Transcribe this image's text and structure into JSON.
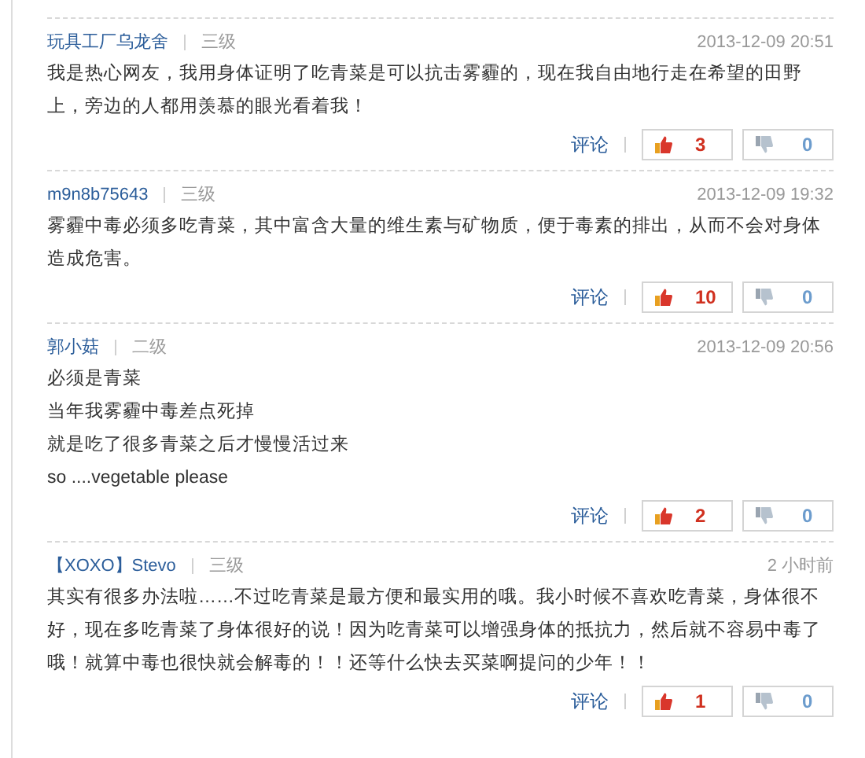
{
  "comments": [
    {
      "user": "玩具工厂乌龙舍",
      "level": "三级",
      "time": "2013-12-09 20:51",
      "lines": [
        "我是热心网友，我用身体证明了吃青菜是可以抗击雾霾的，现在我自由地行走在希望的田野上，旁边的人都用羡慕的眼光看着我！"
      ],
      "reply": "评论",
      "likes": "3",
      "dislikes": "0"
    },
    {
      "user": "m9n8b75643",
      "level": "三级",
      "time": "2013-12-09 19:32",
      "lines": [
        "雾霾中毒必须多吃青菜，其中富含大量的维生素与矿物质，便于毒素的排出，从而不会对身体造成危害。"
      ],
      "reply": "评论",
      "likes": "10",
      "dislikes": "0"
    },
    {
      "user": "郭小菇",
      "level": "二级",
      "time": "2013-12-09 20:56",
      "lines": [
        "必须是青菜",
        "当年我雾霾中毒差点死掉",
        "就是吃了很多青菜之后才慢慢活过来",
        "so ....vegetable please"
      ],
      "reply": "评论",
      "likes": "2",
      "dislikes": "0"
    },
    {
      "user": "【XOXO】Stevo",
      "level": "三级",
      "time": "2 小时前",
      "lines": [
        "其实有很多办法啦……不过吃青菜是最方便和最实用的哦。我小时候不喜欢吃青菜，身体很不好，现在多吃青菜了身体很好的说！因为吃青菜可以增强身体的抵抗力，然后就不容易中毒了哦！就算中毒也很快就会解毒的！！还等什么快去买菜啊提问的少年！！"
      ],
      "reply": "评论",
      "likes": "1",
      "dislikes": "0"
    }
  ]
}
